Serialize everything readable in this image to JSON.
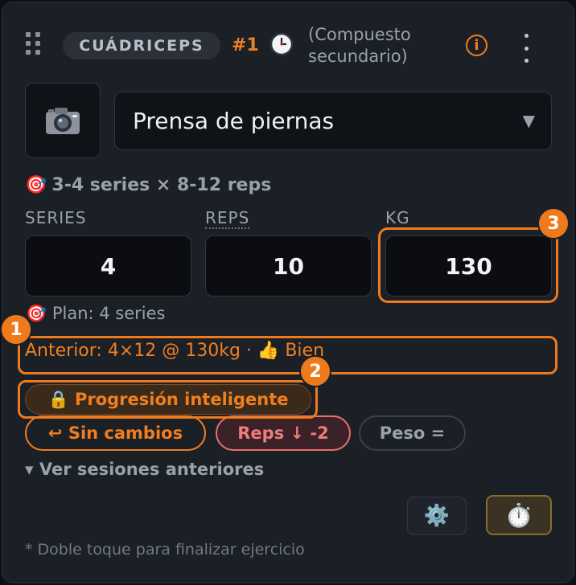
{
  "header": {
    "muscle_badge": "CUÁDRICEPS",
    "order": "#1",
    "clock_icon": "alarm-clock-icon",
    "role_line1": "(Compuesto",
    "role_line2": "secundario)",
    "info_label": "i"
  },
  "exercise": {
    "selected": "Prensa de piernas",
    "caret": "▼",
    "camera_icon": "camera-icon"
  },
  "target": {
    "emoji": "🎯",
    "text": "3-4 series × 8-12 reps"
  },
  "fields": {
    "series_label": "SERIES",
    "series_value": "4",
    "reps_label": "REPS",
    "reps_value": "10",
    "kg_label": "KG",
    "kg_value": "130"
  },
  "plan": {
    "emoji": "🎯",
    "text": "Plan: 4 series"
  },
  "previous": {
    "text": "Anterior: 4×12 @ 130kg · ",
    "emoji": "👍",
    "rating": "Bien"
  },
  "smart_progression": {
    "emoji": "🔒",
    "label": "Progresión inteligente"
  },
  "chips": {
    "same": "↩ Sin cambios",
    "reps": "Reps ↓ -2",
    "peso": "Peso ="
  },
  "history_link": "▾ Ver sesiones anteriores",
  "actions": {
    "settings_emoji": "⚙️",
    "timer_emoji": "⏱️"
  },
  "footnote": "* Doble toque para finalizar ejercicio",
  "annotations": {
    "m1": "1",
    "m2": "2",
    "m3": "3"
  },
  "colors": {
    "accent": "#f07f1f",
    "danger": "#ef7b7b",
    "card": "#1b1f26"
  }
}
